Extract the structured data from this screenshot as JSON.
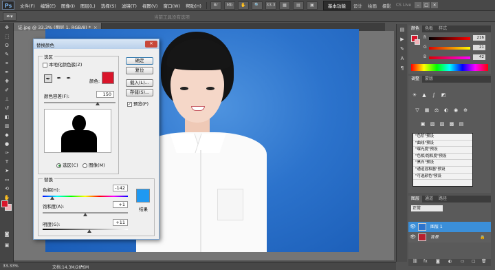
{
  "menubar": {
    "logo": "Ps",
    "items": [
      "文件(F)",
      "编辑(E)",
      "图像(I)",
      "图层(L)",
      "选择(S)",
      "滤镜(T)",
      "视图(V)",
      "窗口(W)",
      "帮助(H)"
    ],
    "zoom_readout": "33.3",
    "workspace_button": "基本功能",
    "workspace_links": [
      "设计",
      "绘画",
      "摄影"
    ],
    "cs_live": "CS Live"
  },
  "optbar": {
    "hint": "当前工具没有选项"
  },
  "doctab": {
    "title": "证.jpg @ 33.3% (图层 1, RGB/8) *"
  },
  "dialog": {
    "title": "替换颜色",
    "selection_group": "选区",
    "localized_label": "本地化颜色簇(Z)",
    "color_label": "颜色:",
    "color_swatch": "#d9152a",
    "tolerance_label": "颜色容差(F):",
    "tolerance_value": "150",
    "tolerance_level": 0.75,
    "radio_selection": "选区(C)",
    "radio_image": "图像(M)",
    "replace_group": "替换",
    "hue_label": "色相(H):",
    "hue_value": "-142",
    "hue_level": 0.11,
    "saturation_label": "饱和度(A):",
    "saturation_value": "+1",
    "saturation_level": 0.5,
    "lightness_label": "明度(G):",
    "lightness_value": "+11",
    "lightness_level": 0.55,
    "result_label": "结果",
    "result_swatch": "#1f99f2",
    "buttons": {
      "ok": "确定",
      "reset": "复位",
      "load": "载入(L)...",
      "save": "存储(S)..."
    },
    "preview_label": "预览(P)"
  },
  "color_panel": {
    "tabs": [
      "颜色",
      "色板",
      "样式"
    ],
    "r_value": "216",
    "g_value": "21",
    "b_value": "42"
  },
  "adjust_panel": {
    "tabs": [
      "调整",
      "蒙版"
    ],
    "presets": [
      "\"色阶\"预设",
      "\"曲线\"预设",
      "\"曝光度\"预设",
      "\"色相/饱和度\"预设",
      "\"黑白\"预设",
      "\"通道混和器\"预设",
      "\"可选颜色\"预设"
    ]
  },
  "layers_panel": {
    "tabs": [
      "图层",
      "通道",
      "路径"
    ],
    "blend_mode": "正常",
    "layers": [
      {
        "name": "图层 1",
        "selected": true
      },
      {
        "name": "背景",
        "selected": false
      }
    ]
  },
  "status": {
    "zoom": "33.33%",
    "doc_info": "文档:14.3M/28.6M"
  },
  "colors": {
    "foreground": "#d9152a",
    "background": "#f0b2b8",
    "accent": "#2c73cc"
  }
}
